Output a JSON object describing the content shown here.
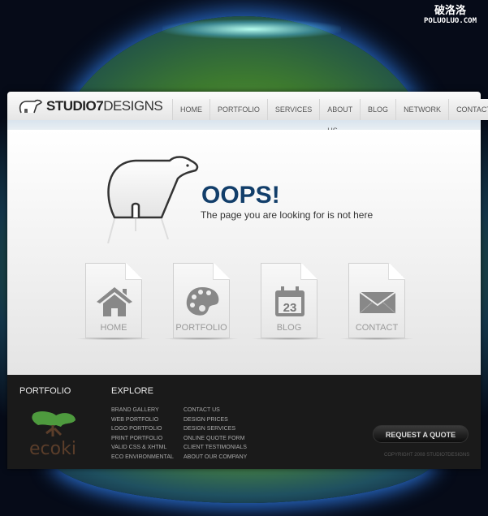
{
  "watermark": {
    "cn": "破洛洛",
    "en": "POLUOLUO.COM"
  },
  "brand": {
    "bold": "STUDIO7",
    "light": "DESIGNS"
  },
  "nav": [
    {
      "label": "HOME"
    },
    {
      "label": "PORTFOLIO"
    },
    {
      "label": "SERVICES"
    },
    {
      "label": "ABOUT US"
    },
    {
      "label": "BLOG"
    },
    {
      "label": "NETWORK"
    },
    {
      "label": "CONTACT"
    }
  ],
  "error": {
    "title": "OOPS!",
    "message": "The page you are looking for is not here"
  },
  "tiles": [
    {
      "label": "HOME",
      "icon": "house-icon"
    },
    {
      "label": "PORTFOLIO",
      "icon": "palette-icon"
    },
    {
      "label": "BLOG",
      "icon": "calendar-icon",
      "day": "23"
    },
    {
      "label": "CONTACT",
      "icon": "envelope-icon"
    }
  ],
  "footer": {
    "portfolio_heading": "PORTFOLIO",
    "portfolio_logo": "ecoki",
    "explore_heading": "EXPLORE",
    "col1": [
      "BRAND GALLERY",
      "WEB PORTFOLIO",
      "LOGO PORTFOLIO",
      "PRINT PORTFOLIO",
      "VALID CSS & XHTML",
      "ECO ENVIRONMENTAL"
    ],
    "col2": [
      "CONTACT US",
      "DESIGN PRICES",
      "DESIGN SERVICES",
      "ONLINE QUOTE FORM",
      "CLIENT TESTIMONIALS",
      "ABOUT OUR COMPANY"
    ],
    "quote_button": "REQUEST A QUOTE",
    "copyright": "COPYRIGHT 2008 STUDIO7DESIGNS"
  },
  "colors": {
    "accent": "#123e6a",
    "footer_bg": "#1a1a1a"
  }
}
